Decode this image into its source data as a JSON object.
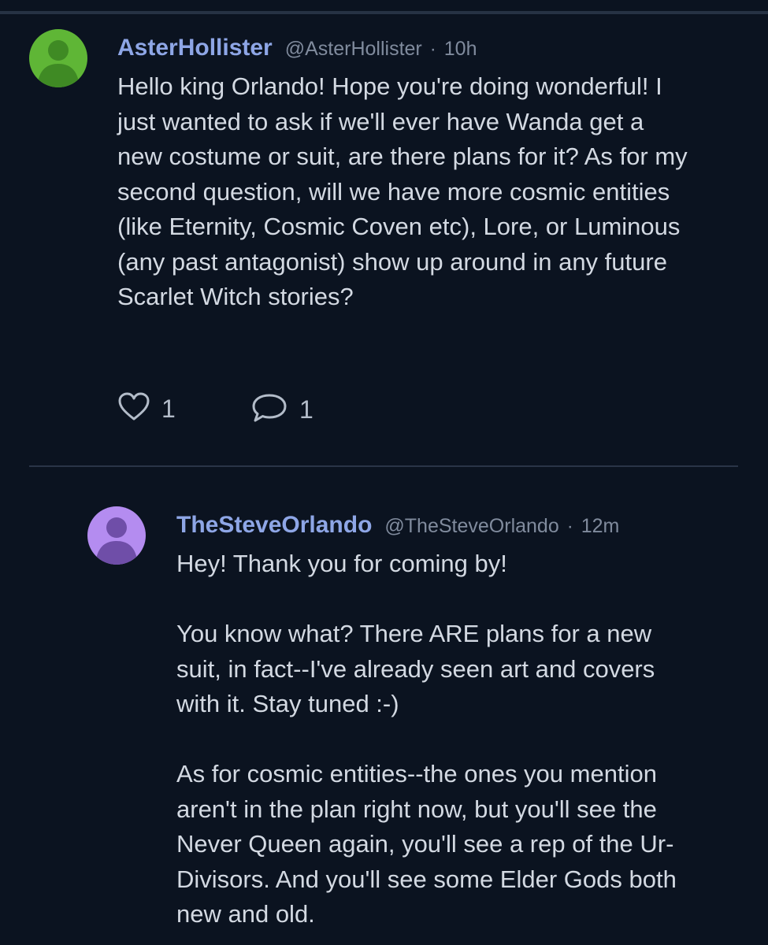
{
  "post": {
    "author": {
      "display_name": "AsterHollister",
      "handle": "@AsterHollister",
      "separator": "·",
      "time": "10h",
      "avatar_color": "#5fb636"
    },
    "text": "Hello king Orlando! Hope you're doing wonderful! I just wanted to ask if we'll ever have Wanda get a new costume or suit, are there plans for it? As for my second question, will we have more cosmic entities (like Eternity, Cosmic Coven etc), Lore, or Luminous (any past antagonist) show up around in any future Scarlet Witch stories?",
    "likes": "1",
    "replies": "1"
  },
  "reply": {
    "author": {
      "display_name": "TheSteveOrlando",
      "handle": "@TheSteveOrlando",
      "separator": "·",
      "time": "12m",
      "avatar_color": "#b48cf0"
    },
    "paragraphs": [
      "Hey! Thank you for coming by!",
      "You know what? There ARE plans for a new suit, in fact--I've already seen art and covers with it. Stay tuned :-)",
      "As for cosmic entities--the ones you mention aren't in the plan right now, but you'll see the Never Queen again, you'll see a rep of the Ur-Divisors. And you'll see some Elder Gods both new and old."
    ]
  },
  "icons": {
    "like": "heart-outline-icon",
    "reply": "speech-bubble-icon"
  },
  "colors": {
    "background": "#0b1320",
    "name": "#8ea6e6",
    "muted": "#808b9d",
    "text": "#d3d9e2"
  }
}
